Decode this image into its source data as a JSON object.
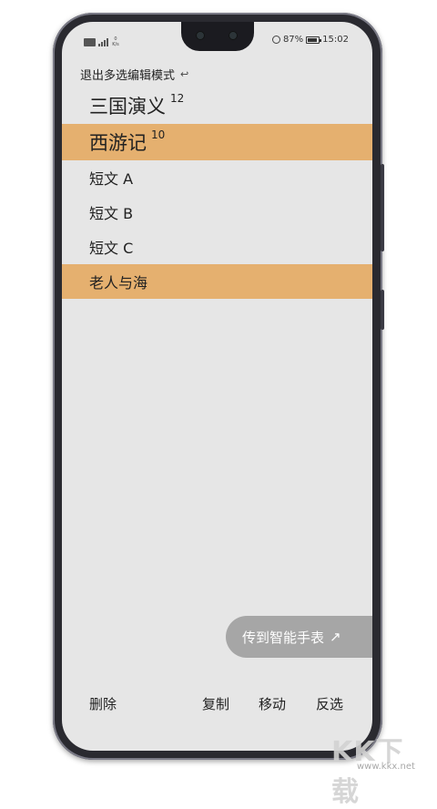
{
  "status": {
    "net_speed": "0 K/s",
    "battery": "87%",
    "battery_level": 0.87,
    "time": "15:02"
  },
  "header": {
    "exit_label": "退出多选编辑模式"
  },
  "items": [
    {
      "title": "三国演义",
      "count": "12",
      "selected": false
    },
    {
      "title": "西游记",
      "count": "10",
      "selected": true
    },
    {
      "title": "短文 A",
      "selected": false
    },
    {
      "title": "短文 B",
      "selected": false
    },
    {
      "title": "短文 C",
      "selected": false
    },
    {
      "title": "老人与海",
      "selected": true
    }
  ],
  "toast": {
    "label": "传到智能手表"
  },
  "toolbar": {
    "delete_label": "删除",
    "copy_label": "复制",
    "move_label": "移动",
    "invert_label": "反选"
  },
  "watermark": {
    "big": "KK下载",
    "small": "www.kkx.net"
  },
  "colors": {
    "selected_row": "#e5b06f",
    "screen_bg": "#e6e6e6",
    "toast_bg": "#a6a6a6"
  }
}
